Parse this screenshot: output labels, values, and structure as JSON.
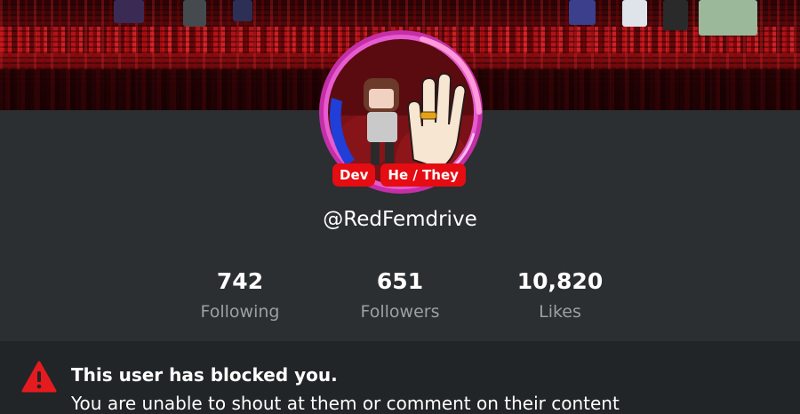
{
  "profile": {
    "badges": [
      "Dev",
      "He / They"
    ],
    "username": "@RedFemdrive"
  },
  "stats": [
    {
      "value": "742",
      "label": "Following"
    },
    {
      "value": "651",
      "label": "Followers"
    },
    {
      "value": "10,820",
      "label": "Likes"
    }
  ],
  "notice": {
    "icon": "warning-triangle-icon",
    "title": "This user has blocked you.",
    "body": "You are unable to shout at them or comment on their content"
  },
  "colors": {
    "background": "#2b2f31",
    "badge": "#e50c12",
    "label_gray": "#9aa0a3",
    "warning_red": "#e41b1f",
    "avatar_ring_pink": "#e23fc0",
    "avatar_ring_blue": "#1f3fd8"
  }
}
